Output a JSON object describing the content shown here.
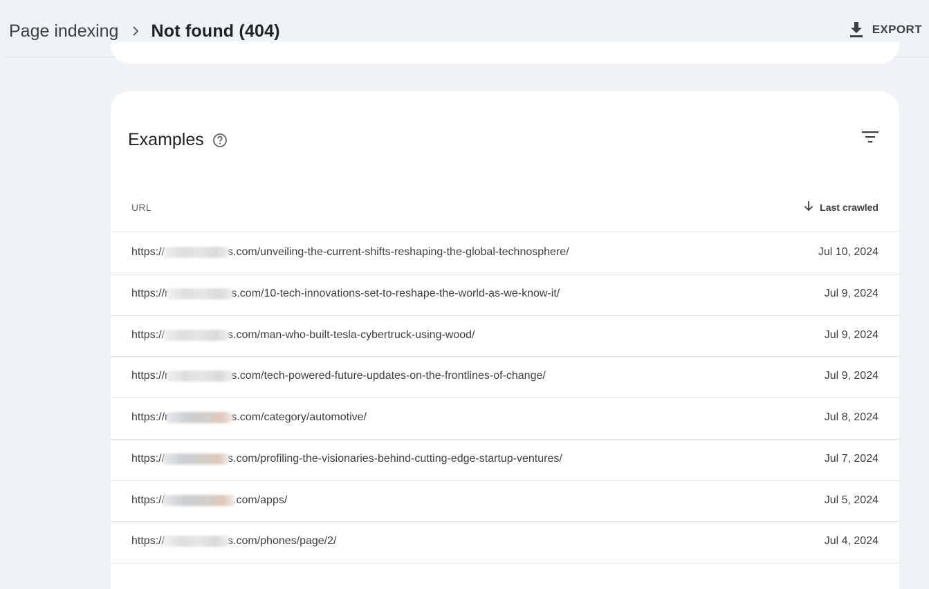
{
  "header": {
    "breadcrumb_root": "Page indexing",
    "breadcrumb_current": "Not found (404)",
    "export_label": "EXPORT"
  },
  "card": {
    "title": "Examples",
    "help_icon": "help-circle-icon",
    "filter_icon": "filter-icon"
  },
  "table": {
    "col_url": "URL",
    "col_date": "Last crawled",
    "sort_icon": "arrow-down-icon",
    "rows": [
      {
        "prefix": "https://",
        "path": "s.com/unveiling-the-current-shifts-reshaping-the-global-technosphere/",
        "date": "Jul 10, 2024"
      },
      {
        "prefix": "https://r",
        "path": "s.com/10-tech-innovations-set-to-reshape-the-world-as-we-know-it/",
        "date": "Jul 9, 2024"
      },
      {
        "prefix": "https://",
        "path": "s.com/man-who-built-tesla-cybertruck-using-wood/",
        "date": "Jul 9, 2024"
      },
      {
        "prefix": "https://r",
        "path": "s.com/tech-powered-future-updates-on-the-frontlines-of-change/",
        "date": "Jul 9, 2024"
      },
      {
        "prefix": "https://r",
        "path": "s.com/category/automotive/",
        "date": "Jul 8, 2024"
      },
      {
        "prefix": "https://",
        "path": "s.com/profiling-the-visionaries-behind-cutting-edge-startup-ventures/",
        "date": "Jul 7, 2024"
      },
      {
        "prefix": "https://",
        "path": ".com/apps/",
        "date": "Jul 5, 2024"
      },
      {
        "prefix": "https://",
        "path": "s.com/phones/page/2/",
        "date": "Jul 4, 2024"
      }
    ]
  }
}
